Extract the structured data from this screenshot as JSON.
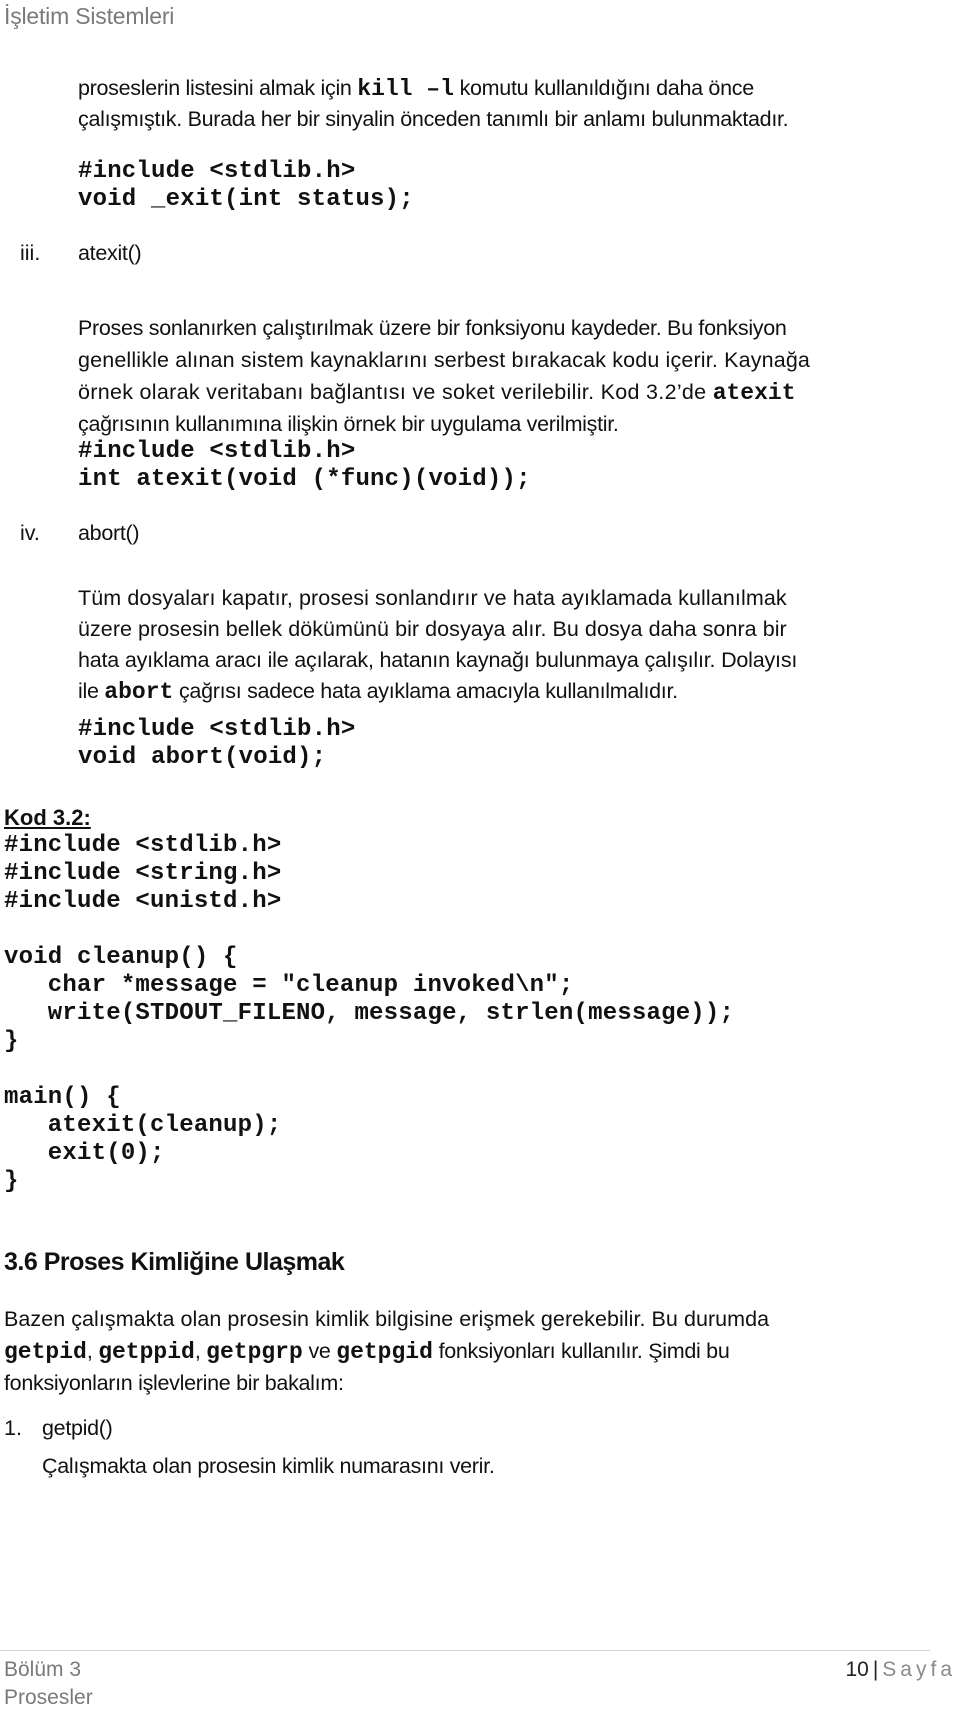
{
  "header": {
    "title": "İşletim Sistemleri"
  },
  "intro": {
    "line1_before": "proseslerin listesini almak için ",
    "line1_code": "kill –l",
    "line1_after": " komutu kullanıldığını daha önce",
    "line2": "çalışmıştık. Burada her bir sinyalin önceden tanımlı bir anlamı bulunmaktadır."
  },
  "exit_proto": [
    "#include <stdlib.h>",
    "void _exit(int status);"
  ],
  "items": [
    {
      "marker": "iii.",
      "title": "atexit()",
      "para_lines": [
        "Proses sonlanırken çalıştırılmak üzere bir fonksiyonu kaydeder. Bu fonksiyon",
        "genellikle alınan sistem kaynaklarını serbest bırakacak kodu içerir. Kaynağa",
        "örnek olarak veritabanı bağlantısı ve soket verilebilir. Kod 3.2’de "
      ],
      "para_code": "atexit",
      "para_last": "çağrısının kullanımına ilişkin örnek bir uygulama verilmiştir.",
      "proto": [
        "#include <stdlib.h>",
        "int atexit(void (*func)(void));"
      ]
    },
    {
      "marker": "iv.",
      "title": "abort()",
      "para_lines": [
        "Tüm dosyaları kapatır, prosesi sonlandırır ve hata ayıklamada kullanılmak",
        "üzere prosesin bellek dökümünü bir dosyaya alır. Bu dosya daha sonra bir",
        "hata ayıklama aracı ile açılarak, hatanın kaynağı bulunmaya çalışılır. Dolayısı"
      ],
      "para_last_before": "ile ",
      "para_code": "abort",
      "para_last_after": " çağrısı sadece hata ayıklama amacıyla kullanılmalıdır.",
      "proto": [
        "#include <stdlib.h>",
        "void abort(void);"
      ]
    }
  ],
  "listing": {
    "label": "Kod 3.2:",
    "lines": [
      "#include <stdlib.h>",
      "#include <string.h>",
      "#include <unistd.h>",
      "",
      "void cleanup() {",
      "   char *message = \"cleanup invoked\\n\";",
      "   write(STDOUT_FILENO, message, strlen(message));",
      "}",
      "",
      "main() {",
      "   atexit(cleanup);",
      "   exit(0);",
      "}"
    ]
  },
  "section": {
    "title": "3.6 Proses Kimliğine Ulaşmak",
    "para_line1": "Bazen çalışmakta olan prosesin kimlik bilgisine erişmek gerekebilir. Bu durumda",
    "para_line2": {
      "c1": "getpid",
      "t1": ", ",
      "c2": "getppid",
      "t2": ", ",
      "c3": "getpgrp",
      "t3": " ve ",
      "c4": "getpgid",
      "t4": " fonksiyonları kullanılır. Şimdi bu"
    },
    "para_line3": "fonksiyonların işlevlerine bir bakalım:",
    "list": [
      {
        "marker": "1.",
        "title": "getpid()",
        "desc": "Çalışmakta olan prosesin kimlik numarasını verir."
      }
    ]
  },
  "footer": {
    "chapter": "Bölüm 3",
    "chapter_name": "Prosesler",
    "page_number": "10",
    "separator": "|",
    "page_word": "Sayfa"
  }
}
